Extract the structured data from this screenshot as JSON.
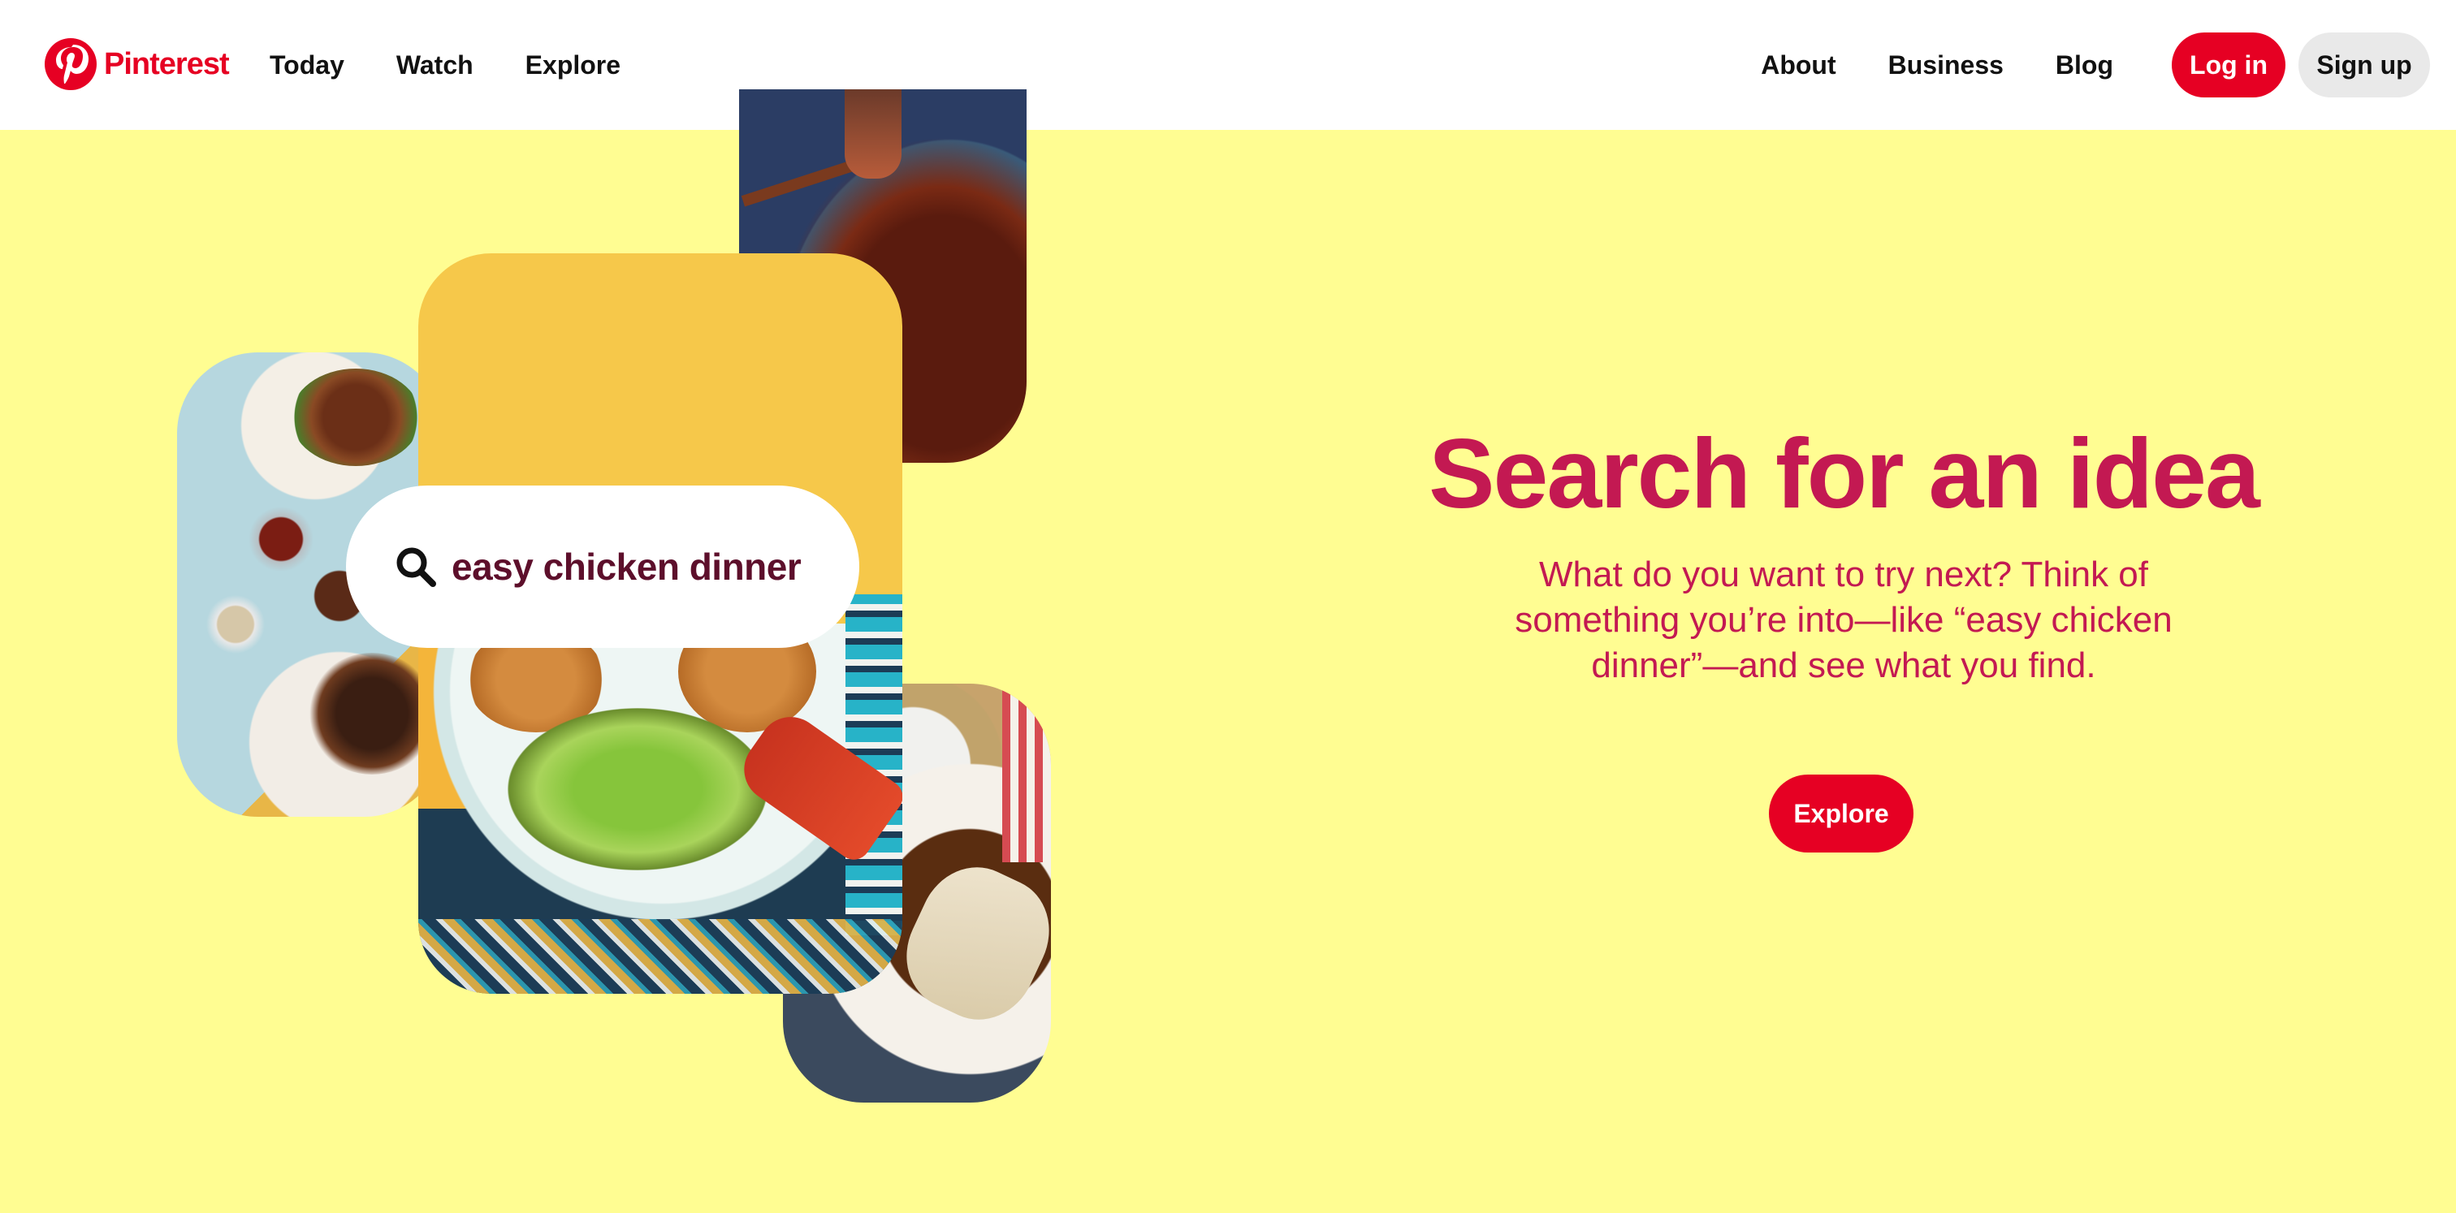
{
  "brand": {
    "name": "Pinterest",
    "color": "#e60023"
  },
  "nav": {
    "left": [
      "Today",
      "Watch",
      "Explore"
    ],
    "right": [
      "About",
      "Business",
      "Blog"
    ],
    "login_label": "Log in",
    "signup_label": "Sign up"
  },
  "hero": {
    "search_text": "easy chicken dinner",
    "title": "Search for an idea",
    "subtitle": "What do you want to try next? Think of something you’re into—like “easy chicken dinner”—and see what you find.",
    "cta_label": "Explore",
    "background_color": "#fffd92",
    "accent_color": "#c31952"
  },
  "icons": {
    "logo": "pinterest-logo-icon",
    "search": "search-icon"
  }
}
